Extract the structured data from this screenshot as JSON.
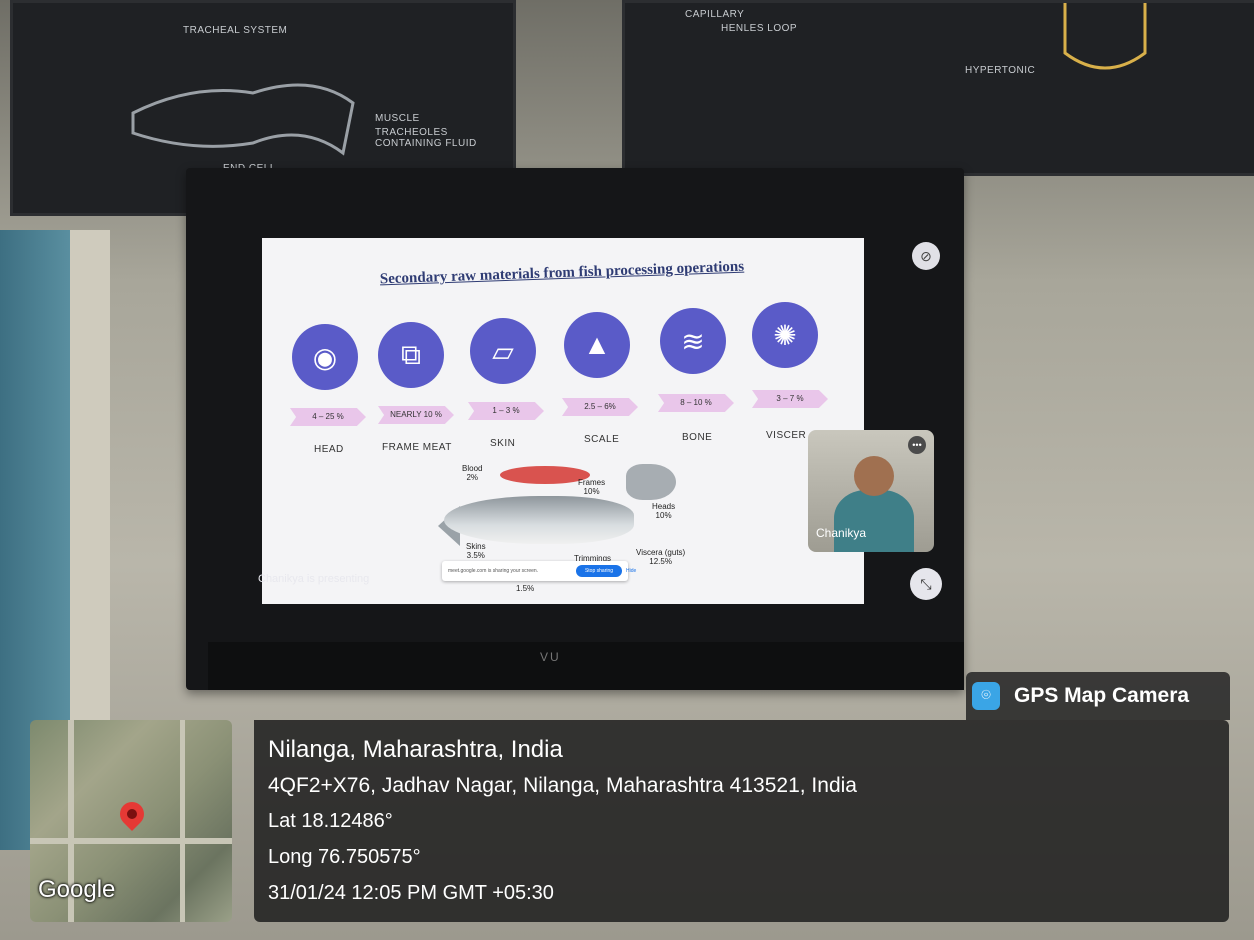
{
  "posters": {
    "left_title": "TRACHEAL SYSTEM",
    "left_labels": [
      "MUSCLE",
      "TRACHEOLES CONTAINING FLUID",
      "END CELL"
    ],
    "right_labels": [
      "CAPILLARY",
      "HENLES LOOP",
      "HYPERTONIC"
    ]
  },
  "tv": {
    "brand": "VU"
  },
  "slide": {
    "title": "Secondary raw materials from fish processing operations",
    "items": [
      {
        "label": "HEAD",
        "percent": "4 – 25 %",
        "icon": "fish-head-icon"
      },
      {
        "label": "FRAME MEAT",
        "percent": "NEARLY 10 %",
        "icon": "fish-frame-icon"
      },
      {
        "label": "SKIN",
        "percent": "1 – 3 %",
        "icon": "fish-skin-icon"
      },
      {
        "label": "SCALE",
        "percent": "2.5 – 6%",
        "icon": "fish-scale-icon"
      },
      {
        "label": "BONE",
        "percent": "8 – 10 %",
        "icon": "fish-bone-icon"
      },
      {
        "label": "VISCER",
        "percent": "3 – 7 %",
        "icon": "viscera-icon"
      }
    ],
    "fish_labels": {
      "blood": "Blood\n2%",
      "frames": "Frames\n10%",
      "heads": "Heads\n10%",
      "skins": "Skins\n3.5%",
      "trimmings": "Trimmings",
      "viscera": "Viscera (guts)\n12.5%",
      "other": "1.5%"
    }
  },
  "meet": {
    "presenting_text": "Chanikya is presenting",
    "share_bar_text": "meet.google.com is sharing your screen.",
    "stop_sharing_label": "Stop sharing",
    "hide_label": "Hide",
    "participant_name": "Chanikya"
  },
  "overlay": {
    "app_name": "GPS Map Camera",
    "map_logo": "Google",
    "location_title": "Nilanga, Maharashtra, India",
    "address": "4QF2+X76, Jadhav Nagar, Nilanga, Maharashtra 413521, India",
    "lat": "Lat 18.12486°",
    "long": "Long 76.750575°",
    "datetime": "31/01/24 12:05 PM GMT +05:30"
  }
}
